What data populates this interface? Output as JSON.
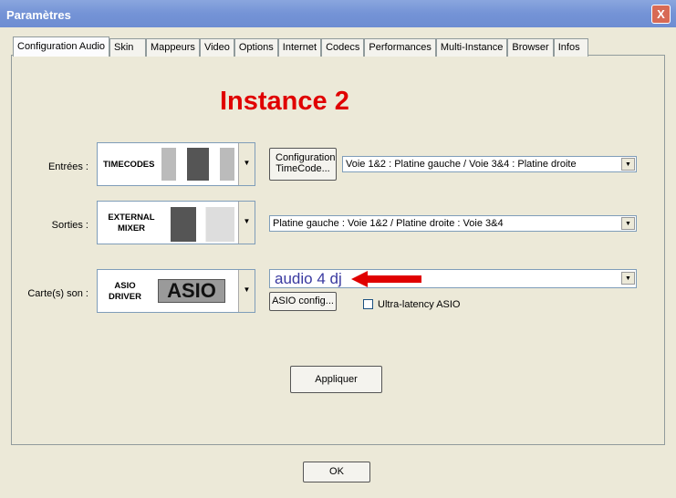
{
  "window": {
    "title": "Paramètres",
    "close": "X"
  },
  "tabs": [
    "Configuration Audio",
    "Skin",
    "Mappeurs",
    "Video",
    "Options",
    "Internet",
    "Codecs",
    "Performances",
    "Multi-Instance",
    "Browser",
    "Infos"
  ],
  "heading": "Instance 2",
  "inputs": {
    "label": "Entrées :",
    "image_caption": "TIMECODES",
    "config_button": "Configuration TimeCode...",
    "routing": "Voie 1&2 : Platine gauche / Voie 3&4 : Platine droite"
  },
  "outputs": {
    "label": "Sorties :",
    "image_caption": "EXTERNAL MIXER",
    "routing": "Platine gauche : Voie 1&2 / Platine droite : Voie 3&4"
  },
  "soundcard": {
    "label": "Carte(s) son :",
    "image_caption": "ASIO DRIVER",
    "logo": "ASIO",
    "device": "audio 4 dj",
    "asio_config": "ASIO config...",
    "ultra_latency": "Ultra-latency ASIO",
    "ultra_latency_checked": false
  },
  "apply": "Appliquer",
  "ok": "OK",
  "colors": {
    "heading": "#e00000",
    "arrow": "#e00000",
    "device": "#3a3aa0"
  }
}
